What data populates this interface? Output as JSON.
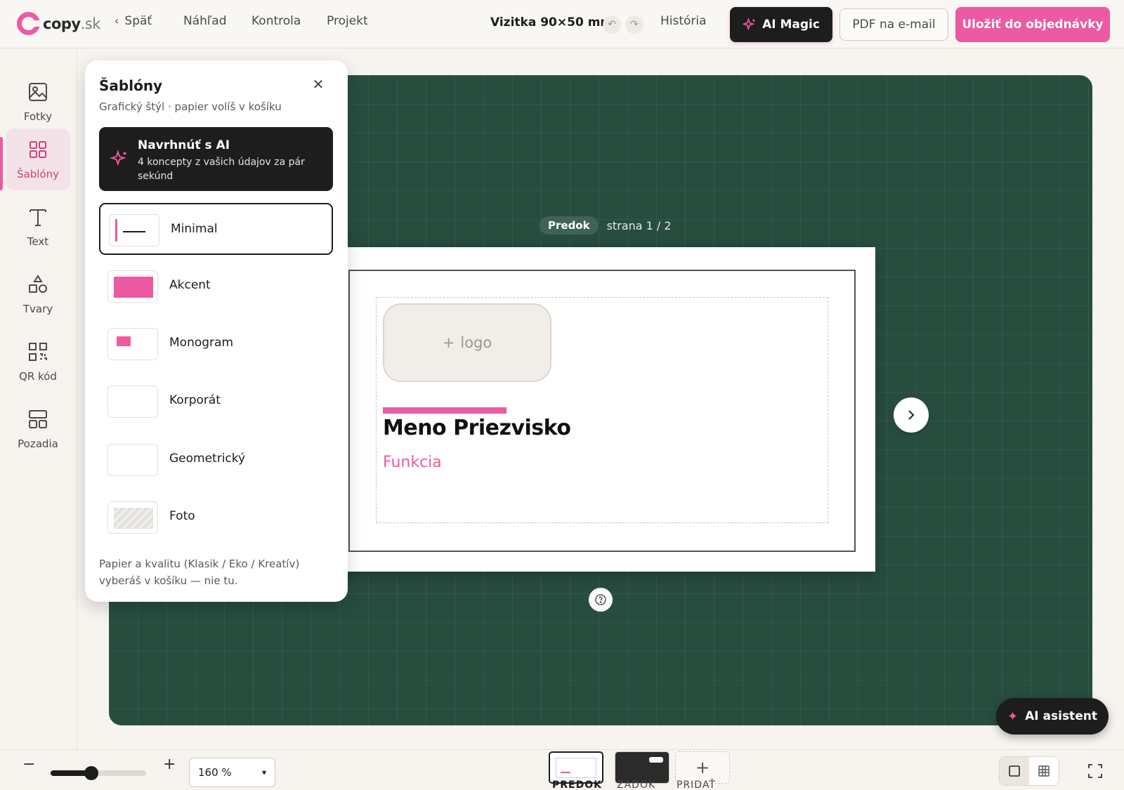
{
  "brand": {
    "name": "copy",
    "tld": ".sk"
  },
  "topbar": {
    "back": "Späť",
    "preview": "Náhľad",
    "check": "Kontrola",
    "project": "Projekt",
    "doc_title": "Vizitka 90×50 mm",
    "history": "História",
    "ai_magic": "AI Magic",
    "pdf_email": "PDF na e-mail",
    "save_order": "Uložiť do objednávky"
  },
  "rail": {
    "items": [
      {
        "label": "Fotky",
        "icon": "image-icon"
      },
      {
        "label": "Šablóny",
        "icon": "grid-icon",
        "active": true
      },
      {
        "label": "Text",
        "icon": "text-icon"
      },
      {
        "label": "Tvary",
        "icon": "shapes-icon"
      },
      {
        "label": "QR kód",
        "icon": "qr-icon"
      },
      {
        "label": "Pozadia",
        "icon": "layout-icon"
      }
    ]
  },
  "panel": {
    "title": "Šablóny",
    "subtitle": "Grafický štýl · papier volíš v košíku",
    "ai": {
      "title": "Navrhnúť s AI",
      "desc": "4 koncepty z vašich údajov za pár sekúnd"
    },
    "templates": [
      {
        "label": "Minimal",
        "selected": true
      },
      {
        "label": "Akcent"
      },
      {
        "label": "Monogram"
      },
      {
        "label": "Korporát"
      },
      {
        "label": "Geometrický"
      },
      {
        "label": "Foto"
      }
    ],
    "footer": "Papier a kvalitu (Klasik / Eko / Kreatív) vyberáš v košíku — nie tu."
  },
  "canvas": {
    "side_badge": "Predok",
    "page_counter": "strana 1 / 2",
    "card": {
      "logo_placeholder": "logo",
      "name": "Meno Priezvisko",
      "function": "Funkcia"
    },
    "ai_assistant": "AI asistent"
  },
  "bottombar": {
    "zoom_select": "160 %",
    "zoom_slider_fraction": 0.43,
    "pages": [
      {
        "label": "PREDOK",
        "active": true
      },
      {
        "label": "ZADOK"
      },
      {
        "label": "PRIDAŤ"
      }
    ]
  },
  "colors": {
    "accent": "#ec5aa2",
    "canvas": "#274d3f",
    "dark": "#1d1d1d"
  }
}
